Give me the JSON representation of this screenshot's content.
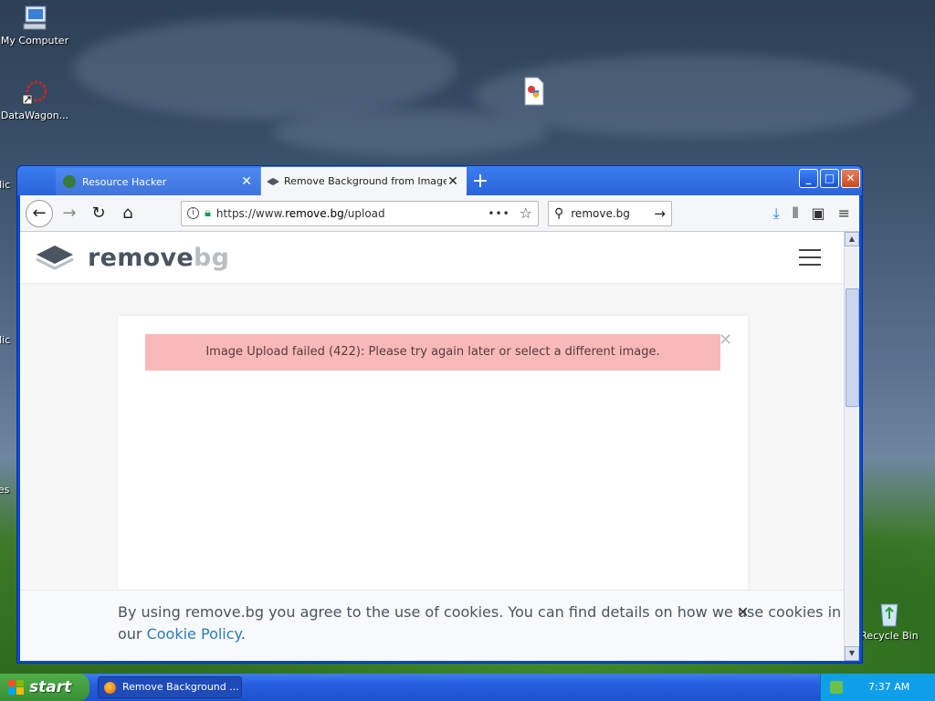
{
  "desktop": {
    "icons": [
      {
        "label": "My Computer"
      },
      {
        "label": "DataWagon..."
      },
      {
        "label": "Recycle Bin"
      }
    ],
    "partial_labels": [
      "Mic",
      "Mic",
      "res"
    ]
  },
  "browser": {
    "tabs": [
      {
        "label": "Resource Hacker",
        "active": false
      },
      {
        "label": "Remove Background from Image",
        "active": true
      }
    ],
    "new_tab": "+",
    "url_prefix": "https://www.",
    "url_domain": "remove.bg",
    "url_path": "/upload",
    "search_value": "remove.bg"
  },
  "page": {
    "logo_main": "remove",
    "logo_accent": "bg",
    "alert_text": "Image Upload failed (422): Please try again later or select a different image.",
    "cookie_text": "By using remove.bg you agree to the use of cookies. You can find details on how we use cookies in our ",
    "cookie_link": "Cookie Policy",
    "cookie_end": "."
  },
  "taskbar": {
    "start_label": "start",
    "task_label": "Remove Background ...",
    "clock": "7:37 AM"
  },
  "colors": {
    "alert_bg": "#f8b9b9",
    "link": "#2b7bbd",
    "xp_blue": "#245ee0",
    "start_green": "#3a8f34"
  }
}
